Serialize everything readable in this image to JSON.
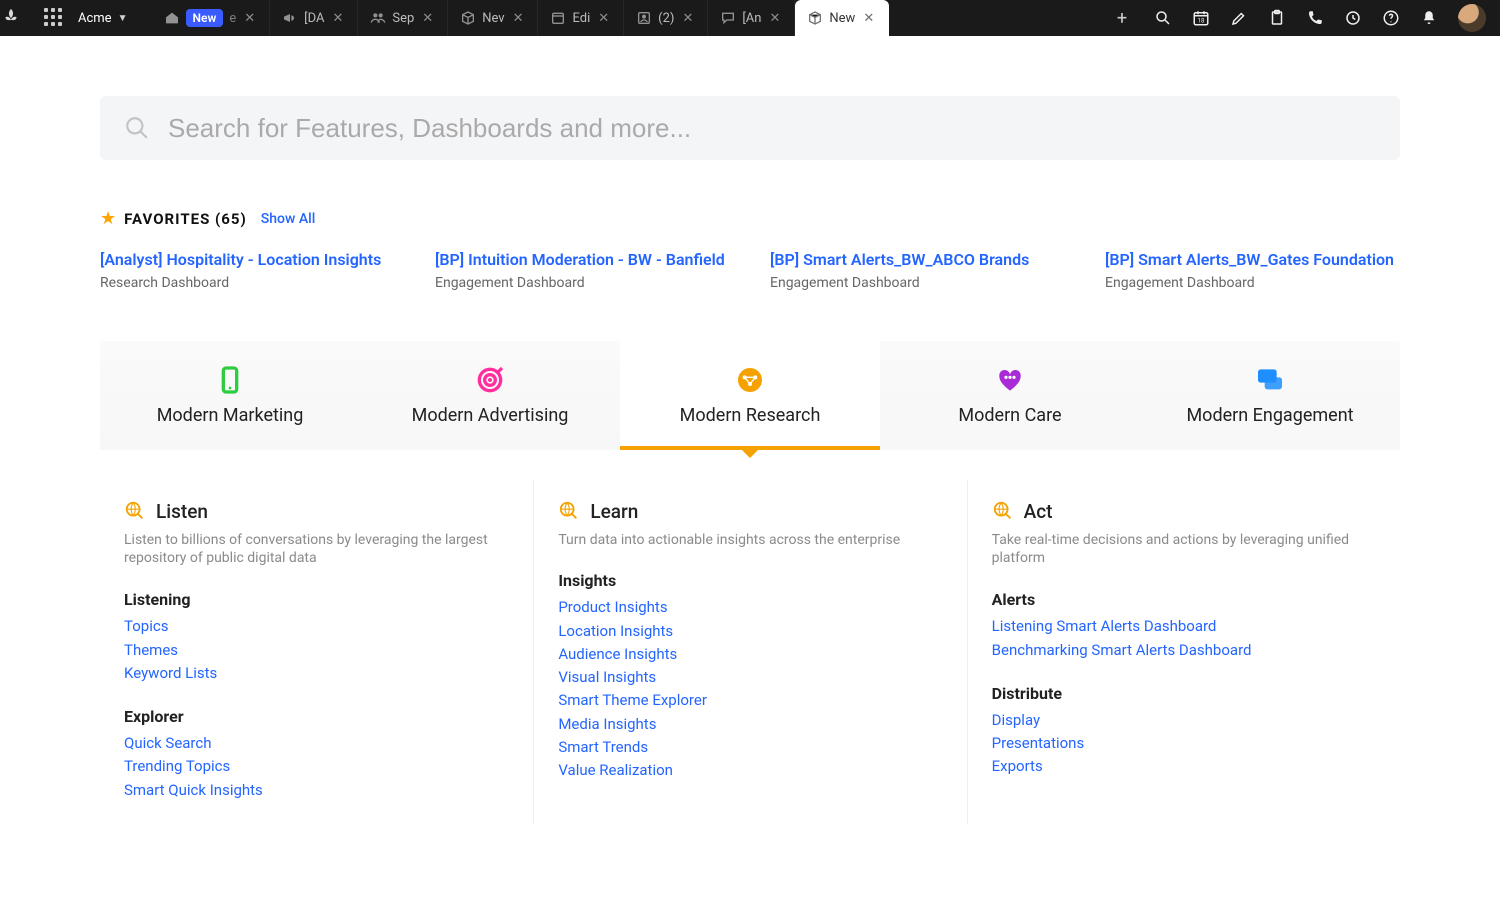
{
  "workspace": {
    "name": "Acme"
  },
  "tabs": [
    {
      "label": "New",
      "badge": true,
      "icon": "home"
    },
    {
      "label": "[DA",
      "icon": "megaphone"
    },
    {
      "label": "Sep",
      "icon": "people"
    },
    {
      "label": "Nev",
      "icon": "cube"
    },
    {
      "label": "Edi",
      "icon": "calendar"
    },
    {
      "label": "(2)",
      "icon": "contact"
    },
    {
      "label": "[An",
      "icon": "chat"
    },
    {
      "label": "New",
      "icon": "cube",
      "active": true
    }
  ],
  "search": {
    "placeholder": "Search for Features, Dashboards and more..."
  },
  "favorites": {
    "title": "FAVORITES",
    "count": "(65)",
    "showAll": "Show All",
    "items": [
      {
        "title": "[Analyst] Hospitality - Location Insights",
        "sub": "Research Dashboard"
      },
      {
        "title": "[BP] Intuition Moderation - BW - Banfield",
        "sub": "Engagement Dashboard"
      },
      {
        "title": "[BP] Smart Alerts_BW_ABCO Brands",
        "sub": "Engagement Dashboard"
      },
      {
        "title": "[BP] Smart Alerts_BW_Gates Foundation",
        "sub": "Engagement Dashboard"
      }
    ]
  },
  "categories": [
    {
      "label": "Modern Marketing",
      "color": "#2ecc40"
    },
    {
      "label": "Modern Advertising",
      "color": "#ff2fa0"
    },
    {
      "label": "Modern Research",
      "color": "#f5a200",
      "active": true
    },
    {
      "label": "Modern Care",
      "color": "#a82bd6"
    },
    {
      "label": "Modern Engagement",
      "color": "#1f8fff"
    }
  ],
  "columns": [
    {
      "title": "Listen",
      "desc": "Listen to billions of conversations by leveraging the largest repository of public digital data",
      "groups": [
        {
          "heading": "Listening",
          "links": [
            "Topics",
            "Themes",
            "Keyword Lists"
          ]
        },
        {
          "heading": "Explorer",
          "links": [
            "Quick Search",
            "Trending Topics",
            "Smart Quick Insights"
          ]
        }
      ]
    },
    {
      "title": "Learn",
      "desc": "Turn data into actionable insights across the enterprise",
      "groups": [
        {
          "heading": "Insights",
          "links": [
            "Product Insights",
            "Location Insights",
            "Audience Insights",
            "Visual Insights",
            "Smart Theme Explorer",
            "Media Insights",
            "Smart Trends",
            "Value Realization"
          ]
        }
      ]
    },
    {
      "title": "Act",
      "desc": "Take real-time decisions and actions by leveraging unified platform",
      "groups": [
        {
          "heading": "Alerts",
          "links": [
            "Listening Smart Alerts Dashboard",
            "Benchmarking Smart Alerts Dashboard"
          ]
        },
        {
          "heading": "Distribute",
          "links": [
            "Display",
            "Presentations",
            "Exports"
          ]
        }
      ]
    }
  ]
}
